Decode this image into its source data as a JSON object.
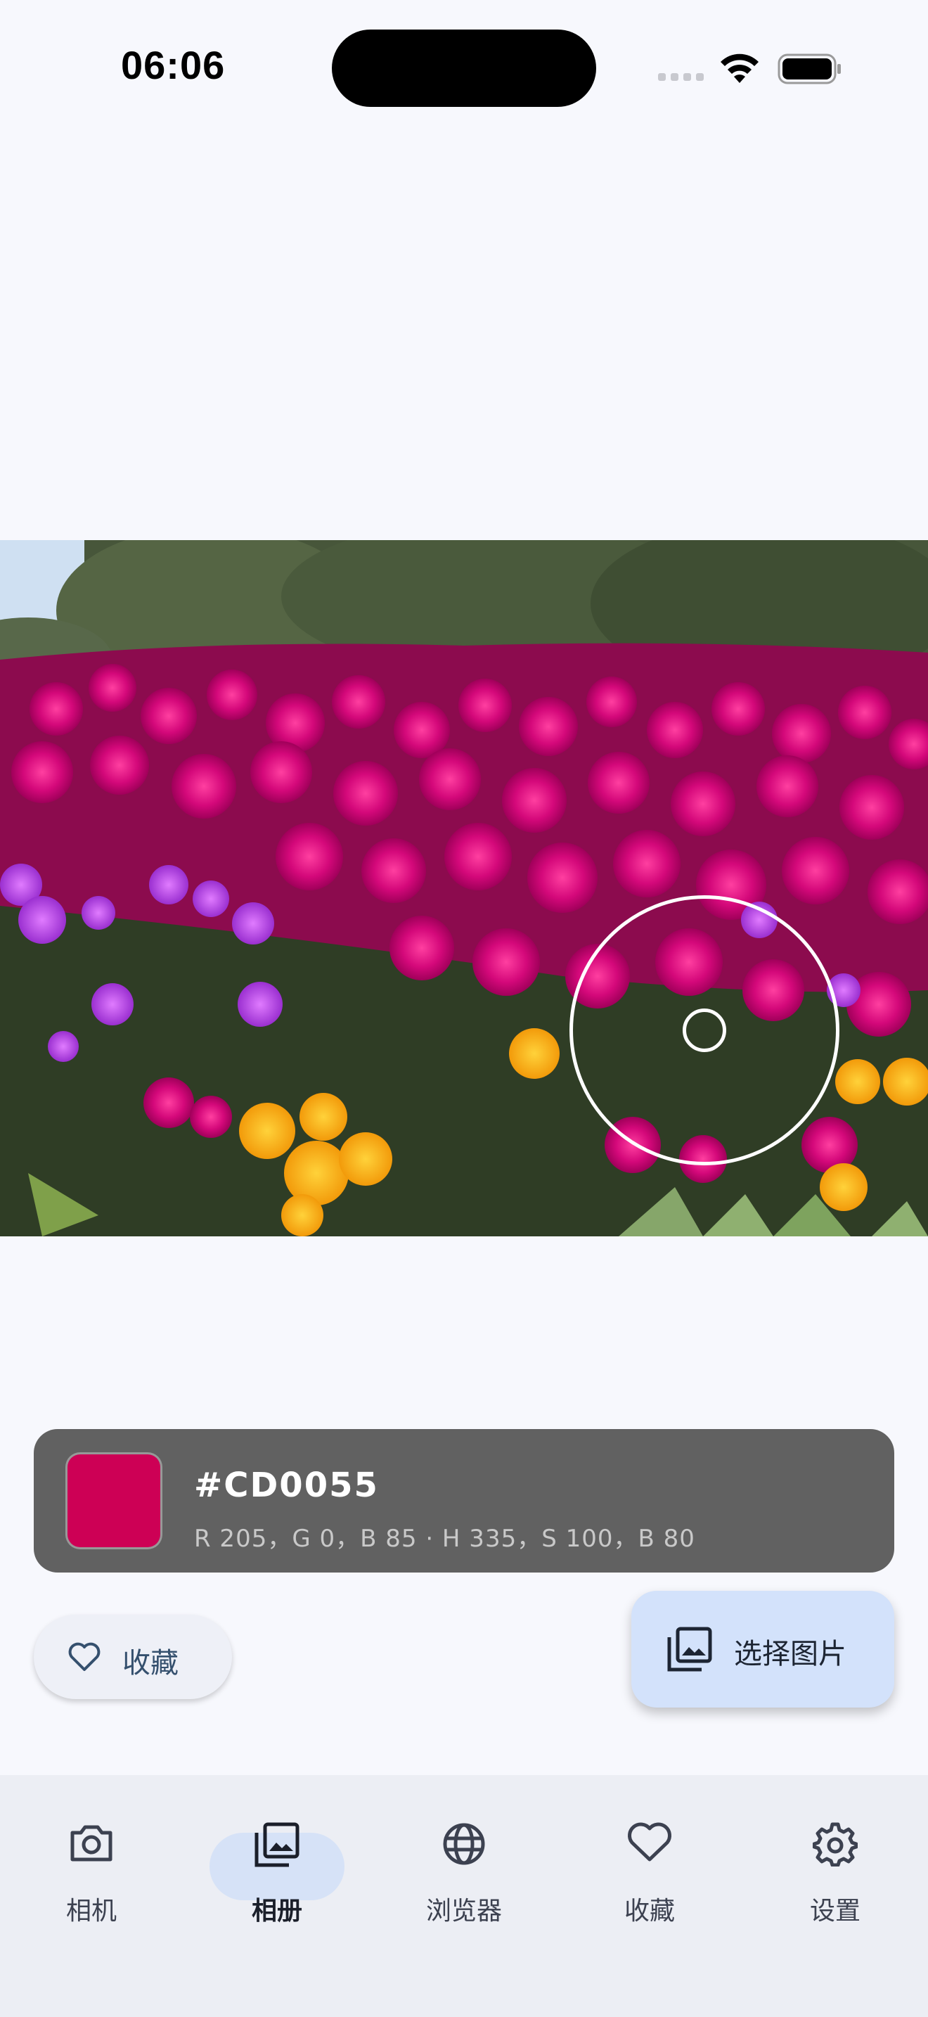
{
  "status_bar": {
    "time": "06:06"
  },
  "image": {
    "description_icon": "flower-photo-icon"
  },
  "color": {
    "hex": "#CD0055",
    "values_text": "R 205，G 0，B 85 · H 335，S 100，B 80",
    "swatch_color": "#CD0055"
  },
  "actions": {
    "favorite_label": "收藏",
    "pick_image_label": "选择图片"
  },
  "nav": {
    "items": [
      {
        "label": "相机",
        "icon": "camera-icon"
      },
      {
        "label": "相册",
        "icon": "gallery-icon",
        "active": true
      },
      {
        "label": "浏览器",
        "icon": "globe-icon"
      },
      {
        "label": "收藏",
        "icon": "heart-icon"
      },
      {
        "label": "设置",
        "icon": "gear-icon"
      }
    ]
  }
}
